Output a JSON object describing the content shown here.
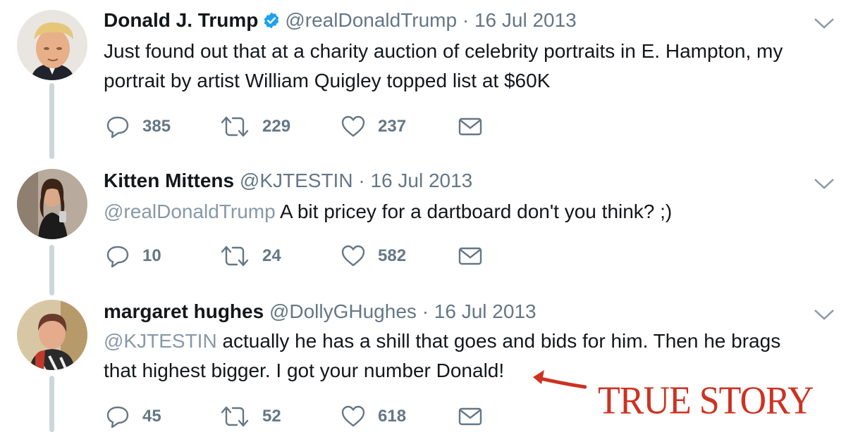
{
  "thread": [
    {
      "name": "Donald J. Trump",
      "verified": true,
      "handle": "@realDonaldTrump",
      "separator": "·",
      "date": "16 Jul 2013",
      "text_lines": [
        "Just found out that at a charity auction of celebrity portraits in E. Hampton, my",
        "portrait by artist William Quigley topped  list at $60K"
      ],
      "replies": "385",
      "retweets": "229",
      "likes": "237",
      "avatar_icon": "avatar-trump"
    },
    {
      "name": "Kitten Mittens",
      "handle": "@KJTESTIN",
      "separator": "·",
      "date": "16 Jul 2013",
      "mention": "@realDonaldTrump",
      "text_lines": [
        "A bit pricey for a dartboard don't you think? ;)"
      ],
      "replies": "10",
      "retweets": "24",
      "likes": "582",
      "avatar_icon": "avatar-kitten"
    },
    {
      "name": "margaret hughes",
      "handle": "@DollyGHughes",
      "separator": "·",
      "date": "16 Jul 2013",
      "mention": "@KJTESTIN",
      "text_lines": [
        " actually he has a shill that goes and bids for him. Then he brags",
        "that highest bigger. I got your number Donald!"
      ],
      "replies": "45",
      "retweets": "52",
      "likes": "618",
      "avatar_icon": "avatar-margaret"
    }
  ],
  "annotation": {
    "label": "TRUE STORY",
    "color": "#cc3322"
  },
  "colors": {
    "verified": "#1da1f2",
    "secondary": "#657786",
    "mention": "#8899a6",
    "thread_line": "#ccd6dd"
  }
}
